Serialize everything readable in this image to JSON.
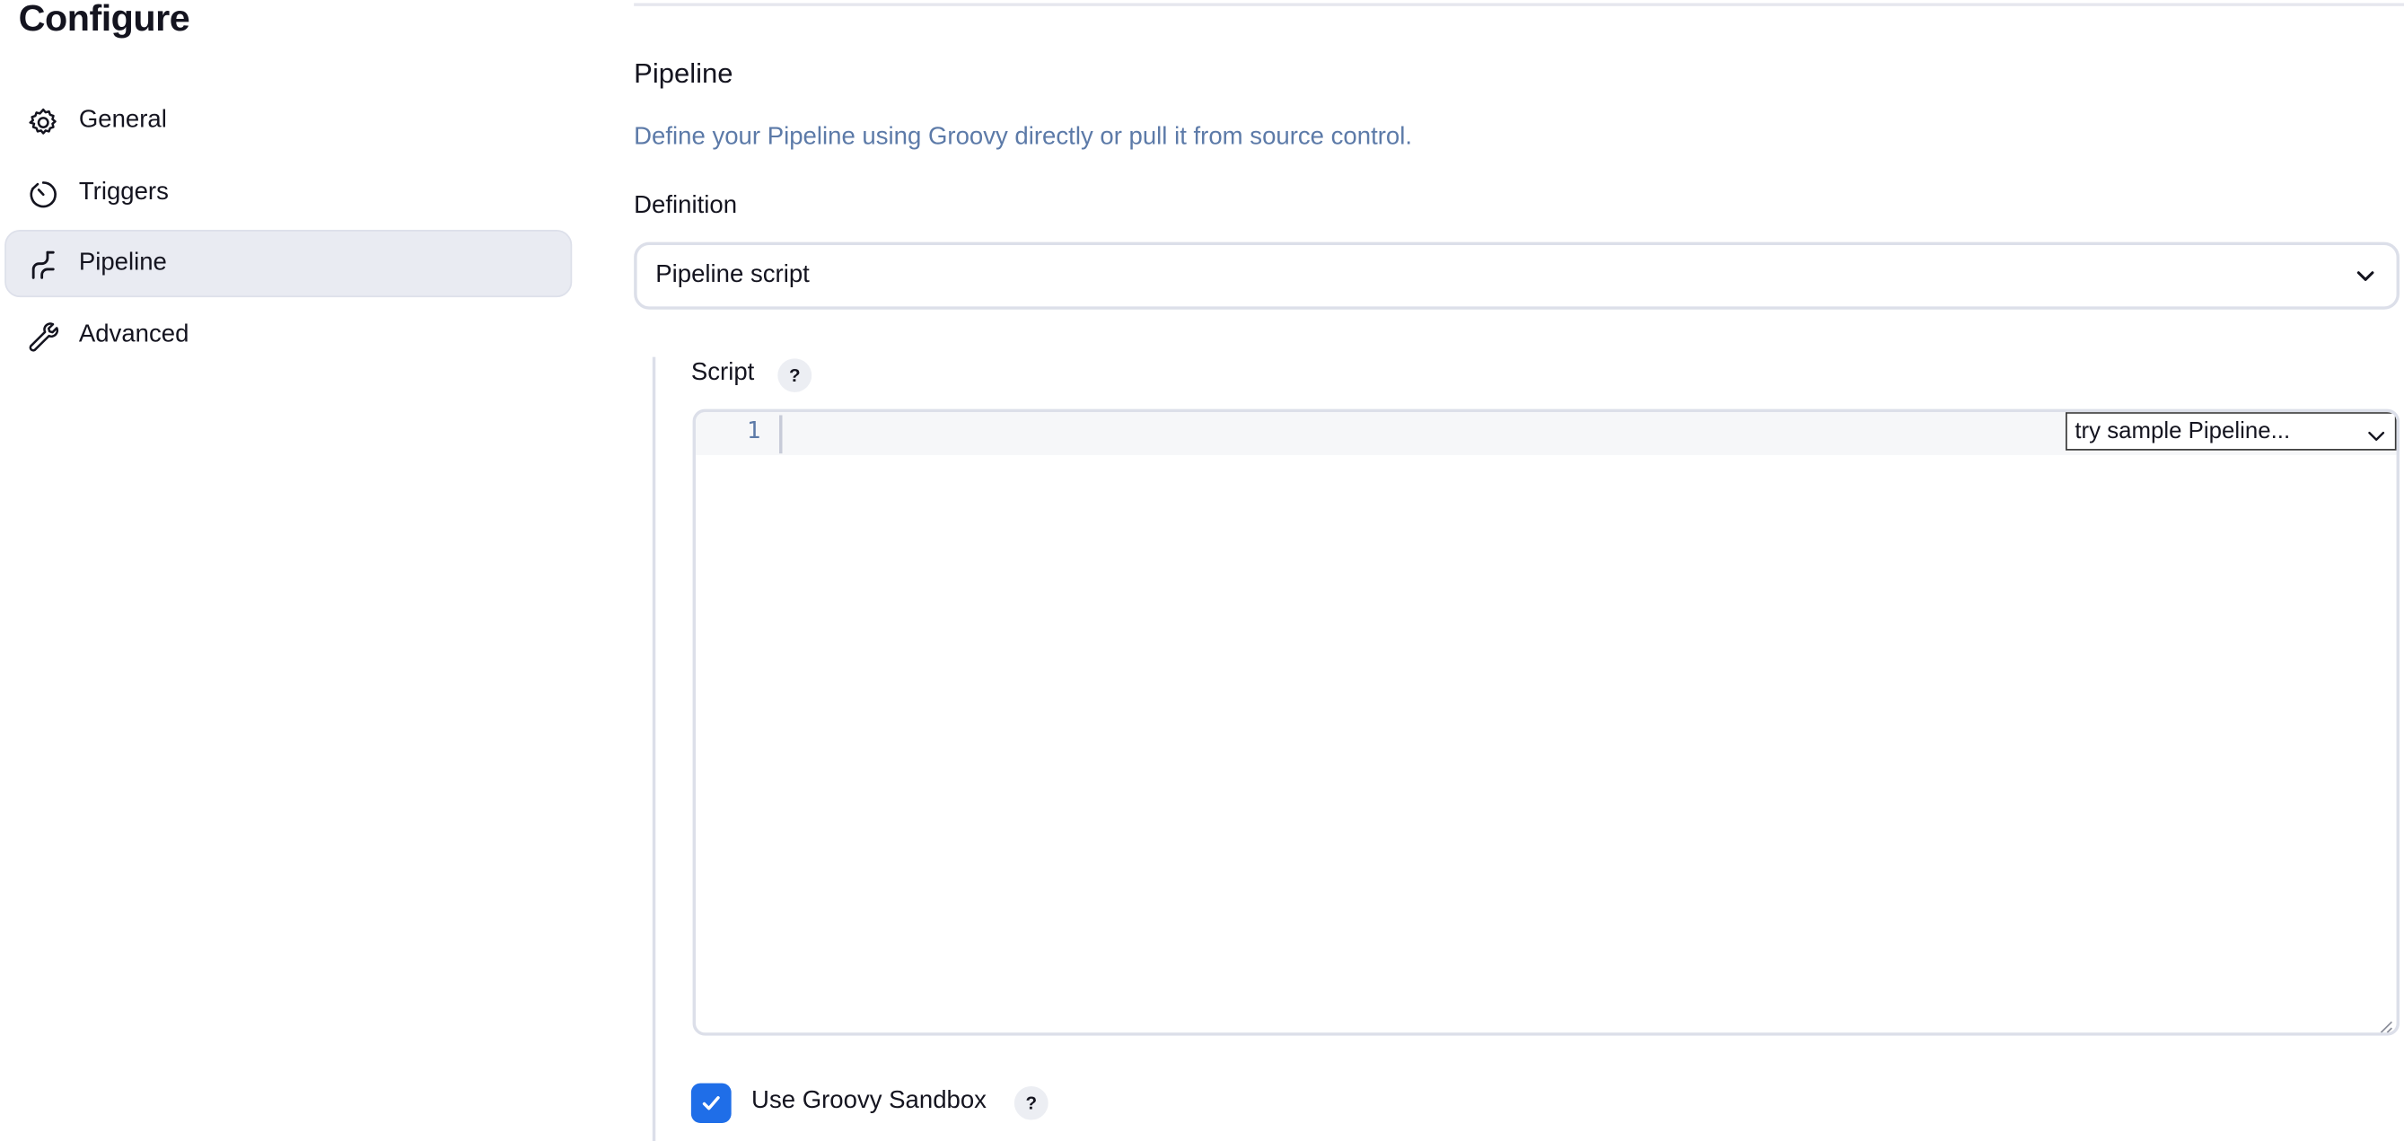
{
  "page": {
    "title": "Configure"
  },
  "sidebar": {
    "items": [
      {
        "label": "General",
        "icon": "gear-icon",
        "active": false
      },
      {
        "label": "Triggers",
        "icon": "timer-icon",
        "active": false
      },
      {
        "label": "Pipeline",
        "icon": "pipeline-icon",
        "active": true
      },
      {
        "label": "Advanced",
        "icon": "wrench-icon",
        "active": false
      }
    ]
  },
  "main": {
    "section_title": "Pipeline",
    "section_description": "Define your Pipeline using Groovy directly or pull it from source control.",
    "definition": {
      "label": "Definition",
      "selected": "Pipeline script"
    },
    "script": {
      "label": "Script",
      "help": "?",
      "line_number": "1",
      "content": "",
      "sample_select": "try sample Pipeline..."
    },
    "sandbox": {
      "label": "Use Groovy Sandbox",
      "checked": true,
      "help": "?"
    }
  },
  "colors": {
    "accent": "#1f6ee8",
    "description_text": "#5c7aa8",
    "active_nav_bg": "#e9ebf2",
    "border": "#dcdfe9"
  }
}
